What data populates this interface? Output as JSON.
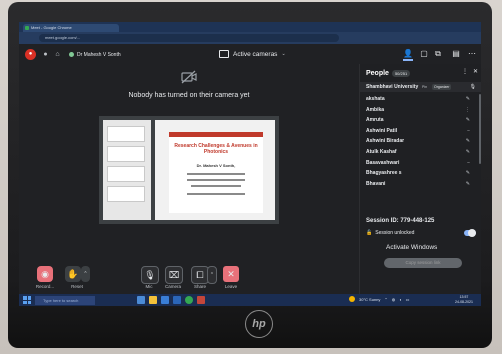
{
  "browser": {
    "tab_title": "Meet - Google Chrome",
    "url": "meet.google.com/..."
  },
  "meet": {
    "presenter": "Dr Mahesh V Sonth",
    "layout_label": "Active cameras",
    "camera_off_message": "Nobody has turned on their camera yet",
    "slide": {
      "title": "Research Challenges & Avenues in Photonics",
      "author": "Dr. Mahesh V Sonth,"
    },
    "controls": [
      {
        "label": "Record...",
        "icon": "record-icon"
      },
      {
        "label": "Reset",
        "icon": "hand-icon"
      },
      {
        "label": "Mic",
        "icon": "mic-off-icon"
      },
      {
        "label": "Camera",
        "icon": "camera-off-icon"
      },
      {
        "label": "Share",
        "icon": "share-icon"
      },
      {
        "label": "Leave",
        "icon": "leave-icon"
      }
    ]
  },
  "people": {
    "title": "People",
    "count": "50/251",
    "organizer_name": "Shambhavi University",
    "organizer_pin": "Pin",
    "organizer_badge": "Organizer",
    "participants": [
      "akshata",
      "Ambika",
      "Amruta",
      "Ashwini Patil",
      "Ashwini Biradar",
      "Atulk Kashaf",
      "Basavashwari",
      "Bhagyashree s",
      "Bhavani"
    ],
    "session_id": "Session ID: 779-448-125",
    "session_status": "Session unlocked",
    "activate_text": "Activate Windows",
    "copy_button": "Copy session link"
  },
  "taskbar": {
    "search_placeholder": "Type here to search",
    "weather": "30°C Sunny",
    "time": "13:57",
    "date": "24-08-2021"
  },
  "colors": {
    "meet_bg": "#202124",
    "leave_red": "#e8717a",
    "taskbar": "#1a2d52",
    "accent": "#8ab4f8"
  }
}
